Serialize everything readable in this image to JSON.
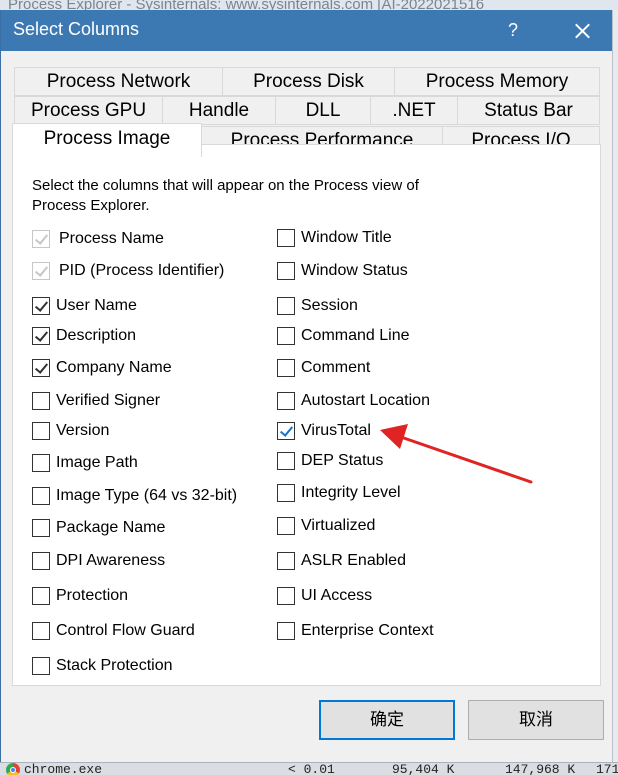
{
  "background": {
    "parent_title": "Process Explorer - Sysinternals: www.sysinternals.com [AI-2022021516",
    "taskbar_process": "chrome.exe",
    "taskbar_cpu": "< 0.01",
    "taskbar_private": "95,404 K",
    "taskbar_working": "147,968 K",
    "taskbar_pid": "171"
  },
  "dialog": {
    "title": "Select Columns",
    "help_label": "?",
    "close_icon": "close-icon",
    "accent_color": "#3c79b3"
  },
  "tabs": {
    "row1": [
      "Process Network",
      "Process Disk",
      "Process Memory"
    ],
    "row2": [
      "Process GPU",
      "Handle",
      "DLL",
      ".NET",
      "Status Bar"
    ],
    "row3": [
      "Process Image",
      "Process Performance",
      "Process I/O"
    ],
    "active": "Process Image"
  },
  "description": "Select the columns that will appear on the Process view of Process Explorer.",
  "left_column": [
    {
      "label": "Process Name",
      "checked": true,
      "disabled": true
    },
    {
      "label": "PID (Process Identifier)",
      "checked": true,
      "disabled": true
    },
    {
      "label": "User Name",
      "checked": true,
      "disabled": false
    },
    {
      "label": "Description",
      "checked": true,
      "disabled": false
    },
    {
      "label": "Company Name",
      "checked": true,
      "disabled": false
    },
    {
      "label": "Verified Signer",
      "checked": false,
      "disabled": false
    },
    {
      "label": "Version",
      "checked": false,
      "disabled": false
    },
    {
      "label": "Image Path",
      "checked": false,
      "disabled": false
    },
    {
      "label": "Image Type (64 vs 32-bit)",
      "checked": false,
      "disabled": false
    },
    {
      "label": "Package Name",
      "checked": false,
      "disabled": false
    },
    {
      "label": "DPI Awareness",
      "checked": false,
      "disabled": false
    },
    {
      "label": "Protection",
      "checked": false,
      "disabled": false
    },
    {
      "label": "Control Flow Guard",
      "checked": false,
      "disabled": false
    },
    {
      "label": "Stack Protection",
      "checked": false,
      "disabled": false
    }
  ],
  "right_column": [
    {
      "label": "Window Title",
      "checked": false
    },
    {
      "label": "Window Status",
      "checked": false
    },
    {
      "label": "Session",
      "checked": false
    },
    {
      "label": "Command Line",
      "checked": false
    },
    {
      "label": "Comment",
      "checked": false
    },
    {
      "label": "Autostart Location",
      "checked": false
    },
    {
      "label": "VirusTotal",
      "checked": true
    },
    {
      "label": "DEP Status",
      "checked": false
    },
    {
      "label": "Integrity Level",
      "checked": false
    },
    {
      "label": "Virtualized",
      "checked": false
    },
    {
      "label": "ASLR Enabled",
      "checked": false
    },
    {
      "label": "UI Access",
      "checked": false
    },
    {
      "label": "Enterprise Context",
      "checked": false
    }
  ],
  "annotation": {
    "icon": "red-arrow-icon",
    "color": "#e02424"
  },
  "buttons": {
    "ok": "确定",
    "cancel": "取消"
  }
}
